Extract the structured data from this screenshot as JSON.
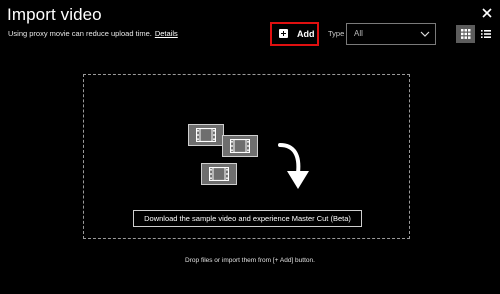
{
  "dialog": {
    "title": "Import video",
    "subtitle": "Using proxy movie can reduce upload time.",
    "details_link": "Details"
  },
  "toolbar": {
    "add_label": "Add",
    "type_label": "Type",
    "type_value": "All",
    "highlight_color": "#e01010"
  },
  "icons": {
    "close": "close-icon",
    "add": "plus-square-icon",
    "dropdown": "chevron-down-icon",
    "grid_view": "grid-view-icon",
    "list_view": "list-view-icon",
    "film": "film-icon",
    "arrow": "curved-arrow-down-icon"
  },
  "dropzone": {
    "sample_button": "Download the sample video and experience Master Cut (Beta)"
  },
  "footer": {
    "hint": "Drop files or import them from [+ Add] button."
  }
}
